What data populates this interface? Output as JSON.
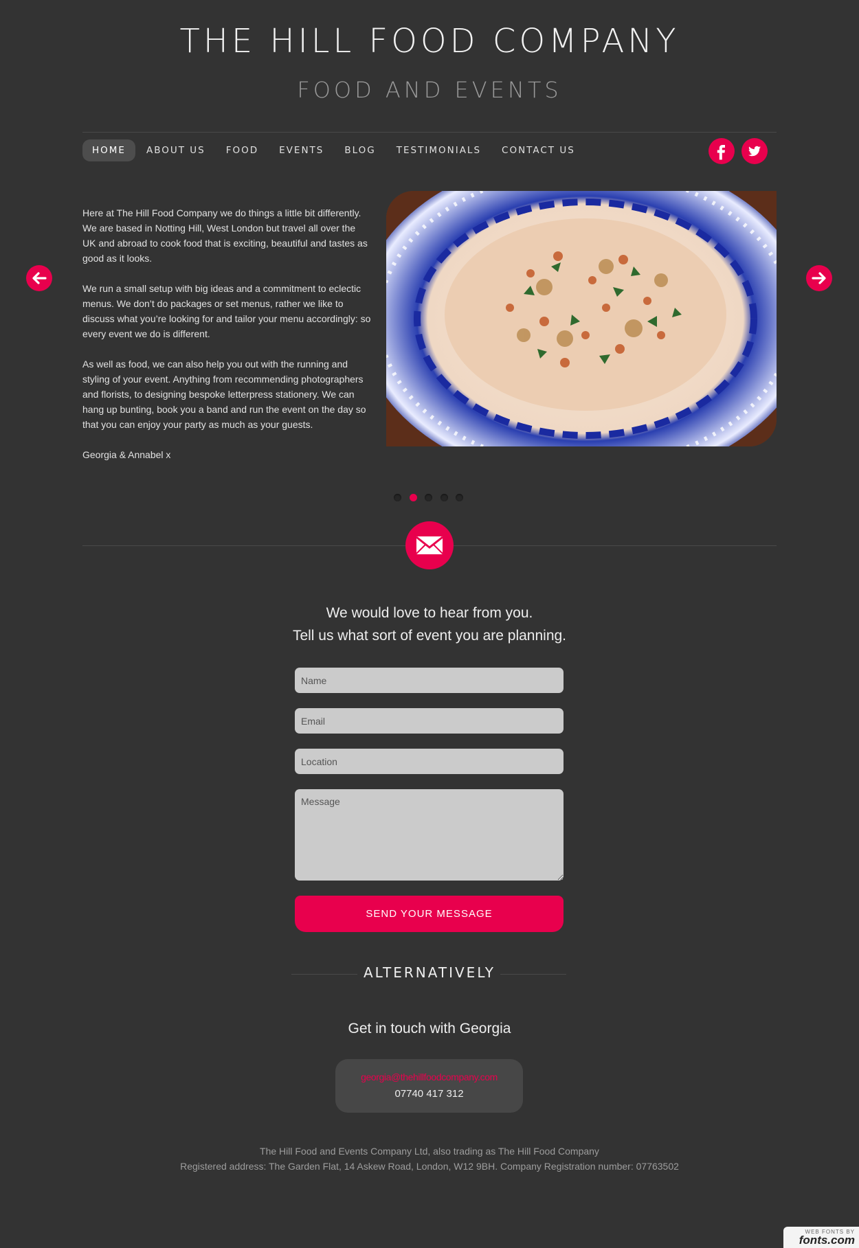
{
  "header": {
    "title": "THE HILL FOOD COMPANY",
    "subtitle": "FOOD AND EVENTS"
  },
  "nav": {
    "items": [
      {
        "label": "HOME",
        "active": true
      },
      {
        "label": "ABOUT US"
      },
      {
        "label": "FOOD"
      },
      {
        "label": "EVENTS"
      },
      {
        "label": "BLOG"
      },
      {
        "label": "TESTIMONIALS"
      },
      {
        "label": "CONTACT US"
      }
    ],
    "social": [
      {
        "icon": "facebook-icon",
        "label": "f"
      },
      {
        "icon": "twitter-icon"
      }
    ]
  },
  "slider": {
    "prev_icon": "arrow-left-icon",
    "next_icon": "arrow-right-icon",
    "paragraphs": [
      "Here at The Hill Food Company we do things a little bit differently. We are based in Notting Hill, West London but travel all over the UK and abroad to cook food that is exciting, beautiful and tastes as good as it looks.",
      "We run a small setup with big ideas and a commitment to eclectic menus. We don’t do packages or set menus, rather we like to discuss what you’re looking for and tailor your menu accordingly: so every event we do is different.",
      "As well as food, we can also help you out with the running and styling of your event. Anything from recommending photographers and florists, to designing bespoke letterpress stationery. We can hang up bunting, book you a band and run the event on the day so that you can enjoy your party as much as your guests.",
      "Georgia & Annabel x"
    ],
    "image_alt": "food plate photo",
    "active_slide": 2,
    "slide_count": 5
  },
  "contact": {
    "badge_icon": "envelope-icon",
    "heading_line1": "We would love to hear from you.",
    "heading_line2": "Tell us what sort of event you are planning.",
    "name_placeholder": "Name",
    "email_placeholder": "Email",
    "location_placeholder": "Location",
    "message_placeholder": "Message",
    "submit_label": "SEND YOUR MESSAGE"
  },
  "alternative": {
    "label": "ALTERNATIVELY",
    "heading": "Get in touch with Georgia",
    "email": "georgia@thehillfoodcompany.com",
    "phone": "07740 417 312"
  },
  "footer": {
    "line1": "The Hill Food and Events Company Ltd, also trading as The Hill Food Company",
    "line2": "Registered address: The Garden Flat, 14 Askew Road, London, W12 9BH. Company Registration number: 07763502"
  },
  "fonts_badge": {
    "small": "WEB FONTS BY",
    "big": "fonts.com"
  },
  "colors": {
    "background": "#333333",
    "accent": "#e8004d",
    "field": "#cbcbcb"
  }
}
